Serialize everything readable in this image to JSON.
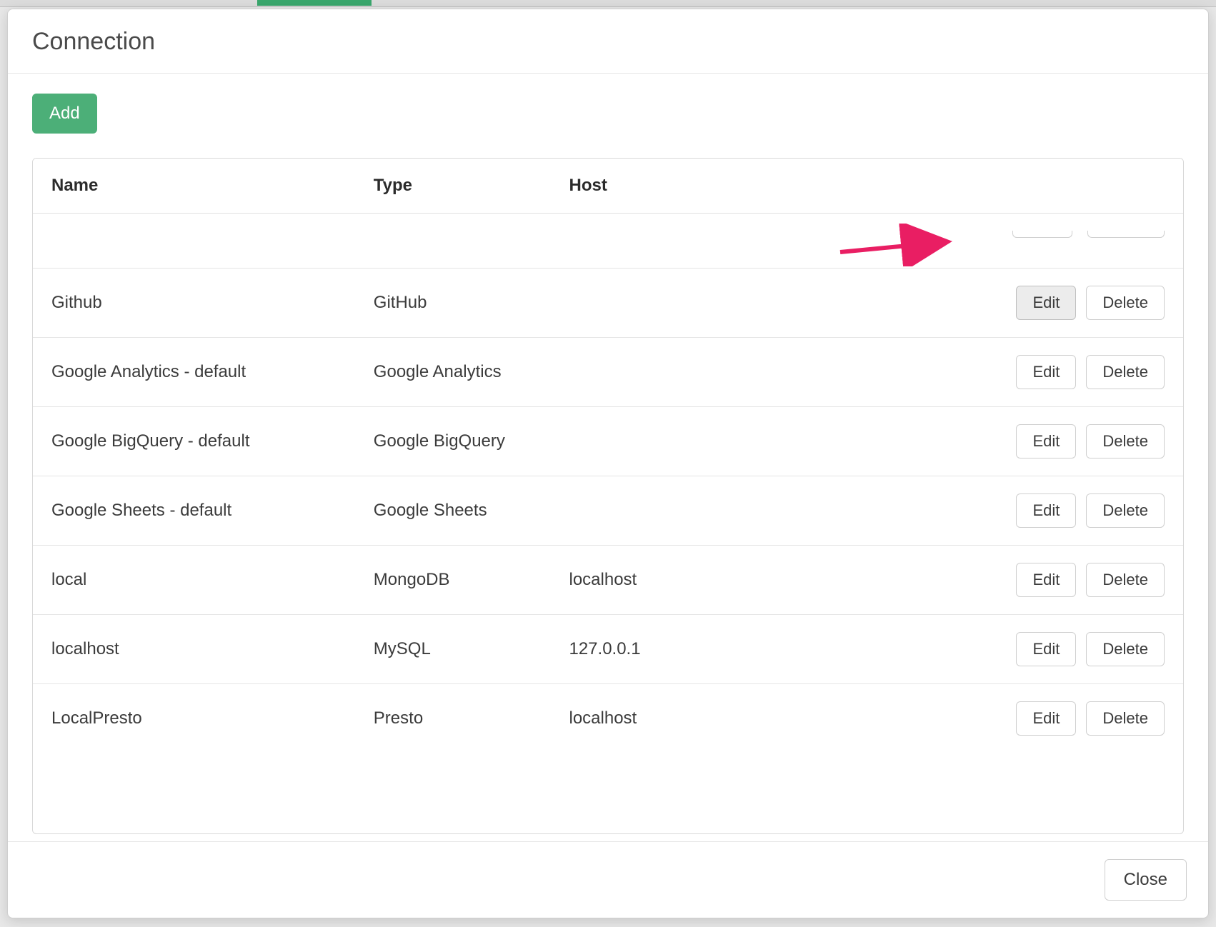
{
  "modal": {
    "title": "Connection",
    "add_label": "Add",
    "close_label": "Close"
  },
  "table": {
    "headers": {
      "name": "Name",
      "type": "Type",
      "host": "Host"
    },
    "edit_label": "Edit",
    "delete_label": "Delete",
    "rows": [
      {
        "name": "Github",
        "type": "GitHub",
        "host": "",
        "highlight_edit": true
      },
      {
        "name": "Google Analytics - default",
        "type": "Google Analytics",
        "host": "",
        "highlight_edit": false
      },
      {
        "name": "Google BigQuery - default",
        "type": "Google BigQuery",
        "host": "",
        "highlight_edit": false
      },
      {
        "name": "Google Sheets - default",
        "type": "Google Sheets",
        "host": "",
        "highlight_edit": false
      },
      {
        "name": "local",
        "type": "MongoDB",
        "host": "localhost",
        "highlight_edit": false
      },
      {
        "name": "localhost",
        "type": "MySQL",
        "host": "127.0.0.1",
        "highlight_edit": false
      },
      {
        "name": "LocalPresto",
        "type": "Presto",
        "host": "localhost",
        "highlight_edit": false
      }
    ]
  },
  "annotation": {
    "arrow_color": "#e91e63"
  }
}
